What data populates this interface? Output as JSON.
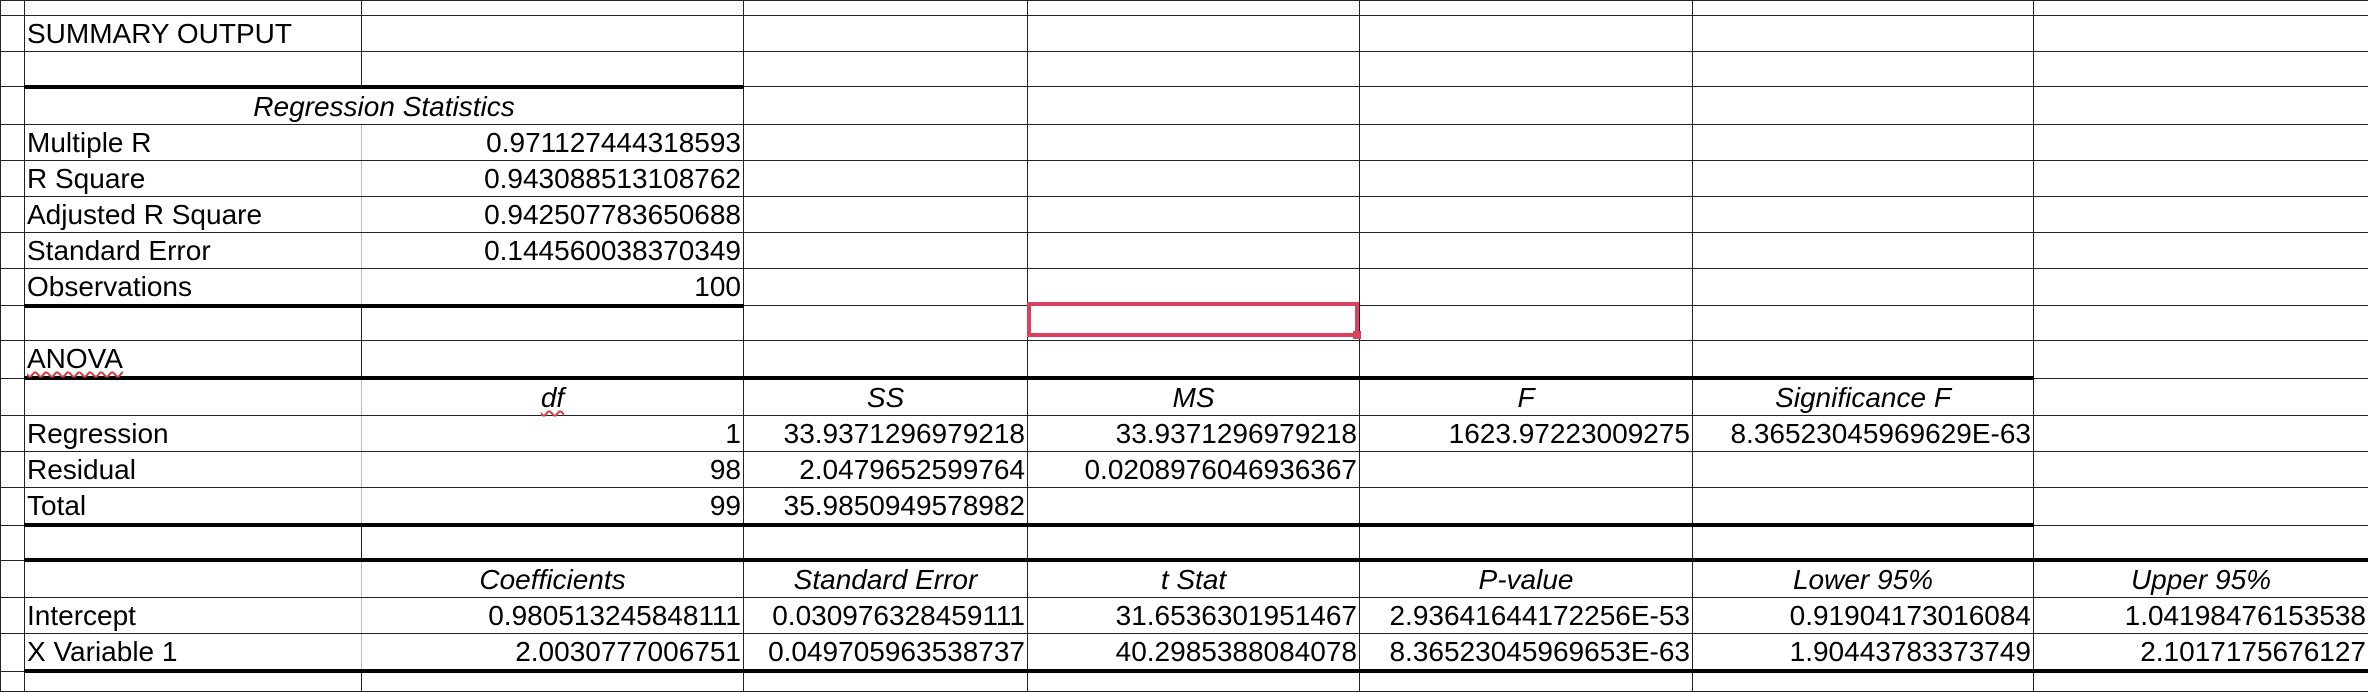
{
  "summary": {
    "title": "SUMMARY OUTPUT"
  },
  "regression_statistics": {
    "header": "Regression Statistics",
    "rows": [
      {
        "label": "Multiple R",
        "value": "0.971127444318593"
      },
      {
        "label": "R Square",
        "value": "0.943088513108762"
      },
      {
        "label": "Adjusted R Square",
        "value": "0.942507783650688"
      },
      {
        "label": "Standard Error",
        "value": "0.144560038370349"
      },
      {
        "label": "Observations",
        "value": "100"
      }
    ]
  },
  "anova": {
    "title": "ANOVA",
    "headers": [
      "df",
      "SS",
      "MS",
      "F",
      "Significance F"
    ],
    "rows": [
      {
        "label": "Regression",
        "df": "1",
        "ss": "33.9371296979218",
        "ms": "33.9371296979218",
        "f": "1623.97223009275",
        "sig_f": "8.36523045969629E-63"
      },
      {
        "label": "Residual",
        "df": "98",
        "ss": "2.0479652599764",
        "ms": "0.0208976046936367",
        "f": "",
        "sig_f": ""
      },
      {
        "label": "Total",
        "df": "99",
        "ss": "35.9850949578982",
        "ms": "",
        "f": "",
        "sig_f": ""
      }
    ]
  },
  "coefficients": {
    "headers": [
      "Coefficients",
      "Standard Error",
      "t Stat",
      "P-value",
      "Lower 95%",
      "Upper 95%"
    ],
    "rows": [
      {
        "label": "Intercept",
        "coef": "0.980513245848111",
        "se": "0.030976328459111",
        "t": "31.6536301951467",
        "p": "2.93641644172256E-53",
        "lower": "0.91904173016084",
        "upper": "1.04198476153538"
      },
      {
        "label": "X Variable 1",
        "coef": "2.0030777006751",
        "se": "0.049705963538737",
        "t": "40.2985388084078",
        "p": "8.36523045969653E-63",
        "lower": "1.90443783373749",
        "upper": "2.1017175676127"
      }
    ]
  },
  "colors": {
    "selection": "#d9415f",
    "spellcheck": "#d04040"
  }
}
